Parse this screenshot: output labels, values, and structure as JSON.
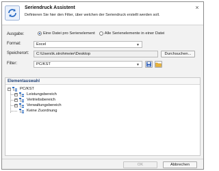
{
  "header": {
    "title": "Seriendruck Assistent",
    "subtitle": "Definieren Sie hier den Filter, über welchen der Seriendruck erstellt werden soll."
  },
  "form": {
    "ausgabe_label": "Ausgabe:",
    "radio_single_label": "Eine Datei pro Serienelement",
    "radio_all_label": "Alle Serienelemente in einer Datei",
    "radio_selected": "single",
    "format_label": "Format:",
    "format_value": "Excel",
    "speicherort_label": "Speicherort:",
    "speicherort_value": "C:\\Users\\k.strohmeier\\Desktop",
    "browse_label": "Durchsuchen...",
    "filter_label": "Filter:",
    "filter_value": "PC/KST"
  },
  "elementauswahl": {
    "title": "Elementauswahl",
    "root": "PC/KST",
    "children": [
      "Leistungsbereich",
      "Vertriebsbereich",
      "Verwaltungsbereich",
      "Keine Zuordnung"
    ]
  },
  "footer": {
    "ok_label": "OK",
    "cancel_label": "Abbrechen"
  },
  "colors": {
    "accent": "#1a4fa0",
    "section_title": "#1f3f73",
    "save_icon": "#2b5bb5",
    "folder_icon": "#e8b33a"
  }
}
